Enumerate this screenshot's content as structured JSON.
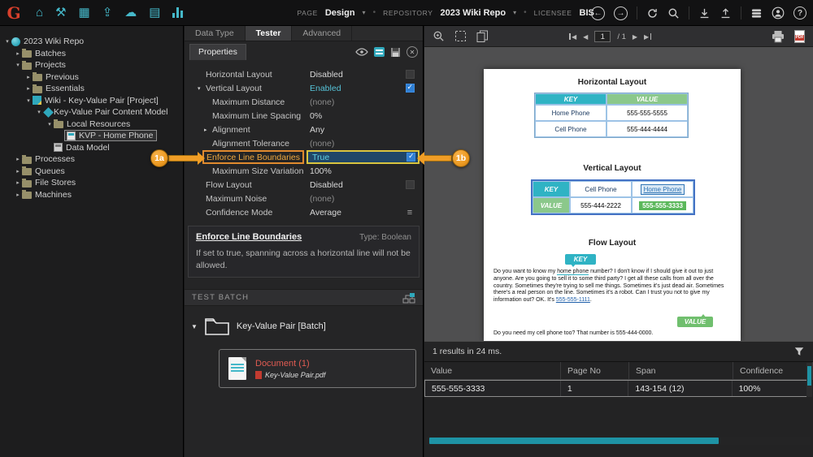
{
  "topbar": {
    "logo": "G",
    "page_label": "PAGE",
    "page_value": "Design",
    "repo_label": "REPOSITORY",
    "repo_value": "2023 Wiki Repo",
    "licensee_label": "LICENSEE",
    "licensee_value": "BIS"
  },
  "icons": {
    "home": "⌂",
    "tools": "⚒",
    "grid": "▦",
    "export": "⇪",
    "cloud": "☁",
    "archive": "▤",
    "back": "←",
    "forward": "→",
    "help": "?",
    "menu": "≡",
    "caret": "▾",
    "dot": "•",
    "tree_open": "▾",
    "tree_closed": "▸",
    "prev": "◀",
    "next": "▶",
    "batch_expand": "▼"
  },
  "tree": {
    "items": [
      {
        "label": "2023 Wiki Repo"
      },
      {
        "label": "Batches"
      },
      {
        "label": "Projects"
      },
      {
        "label": "Previous"
      },
      {
        "label": "Essentials"
      },
      {
        "label": "Wiki - Key-Value Pair [Project]"
      },
      {
        "label": "Key-Value Pair Content Model"
      },
      {
        "label": "Local Resources"
      },
      {
        "label": "KVP - Home Phone"
      },
      {
        "label": "Data Model"
      },
      {
        "label": "Processes"
      },
      {
        "label": "Queues"
      },
      {
        "label": "File Stores"
      },
      {
        "label": "Machines"
      }
    ]
  },
  "tabs": {
    "items": [
      {
        "label": "Data Type"
      },
      {
        "label": "Tester"
      },
      {
        "label": "Advanced"
      }
    ]
  },
  "props": {
    "header": "Properties",
    "rows": [
      {
        "name": "Horizontal Layout",
        "value": "Disabled"
      },
      {
        "name": "Vertical Layout",
        "value": "Enabled"
      },
      {
        "name": "Maximum Distance",
        "value": "(none)"
      },
      {
        "name": "Maximum Line Spacing",
        "value": "0%"
      },
      {
        "name": "Alignment",
        "value": "Any"
      },
      {
        "name": "Alignment Tolerance",
        "value": "(none)"
      },
      {
        "name": "Enforce Line Boundaries",
        "value": "True"
      },
      {
        "name": "Maximum Size Variation",
        "value": "100%"
      },
      {
        "name": "Flow Layout",
        "value": "Disabled"
      },
      {
        "name": "Maximum Noise",
        "value": "(none)"
      },
      {
        "name": "Confidence Mode",
        "value": "Average"
      }
    ],
    "desc": {
      "title": "Enforce Line Boundaries",
      "type": "Type: Boolean",
      "text": "If set to true, spanning across a horizontal line will not be allowed."
    }
  },
  "test_batch": {
    "header": "TEST BATCH",
    "folder_label": "Key-Value Pair [Batch]",
    "doc_title": "Document (1)",
    "doc_file": "Key-Value Pair.pdf"
  },
  "viewer": {
    "nav": {
      "page": "1",
      "total": "/ 1"
    },
    "doc": {
      "title1": "Horizontal Layout",
      "title2": "Vertical Layout",
      "title3": "Flow Layout",
      "htable": {
        "h1": "KEY",
        "h2": "VALUE",
        "r1c1": "Home Phone",
        "r1c2": "555-555-5555",
        "r2c1": "Cell Phone",
        "r2c2": "555-444-4444"
      },
      "vtable": {
        "key": "KEY",
        "value": "VALUE",
        "r1c1": "Cell Phone",
        "r1c2": "Home Phone",
        "r2c1": "555-444-2222",
        "r2c2": "555-555-3333"
      },
      "flow": {
        "key_badge": "KEY",
        "value_badge": "VALUE",
        "p1a": "Do you want to know my ",
        "p1b": "home phone",
        "p1c": " number? I don't know if I should give it out to just anyone. Are you going to sell it to some third party? I get all these calls from all over the country. Sometimes they're trying to sell me things. Sometimes it's just dead air. Sometimes there's a real person on the line. Sometimes it's a robot. Can I trust you not to give my information out? OK. It's ",
        "p1d": "555-555-1111",
        "p1e": ".",
        "p2a": "Do you need my cell phone too? That number is ",
        "p2b": "555-444-0000",
        "p2c": "."
      }
    }
  },
  "results": {
    "summary": "1 results in 24 ms.",
    "cols": [
      {
        "label": "Value"
      },
      {
        "label": "Page No"
      },
      {
        "label": "Span"
      },
      {
        "label": "Confidence"
      }
    ],
    "rows": [
      {
        "value": "555-555-3333",
        "page": "1",
        "span": "143-154 (12)",
        "confidence": "100%"
      }
    ]
  },
  "callouts": {
    "a": "1a",
    "b": "1b"
  },
  "colors": {
    "accent_teal": "#45b8c9",
    "key_teal": "#2fb3c4",
    "value_green": "#8bc88b",
    "callout_orange": "#ef9d26",
    "highlight_yellow": "#d9c43f",
    "enabled_teal": "#56c3d8",
    "document_red": "#e05b52",
    "selection_blue": "#1f4668"
  }
}
